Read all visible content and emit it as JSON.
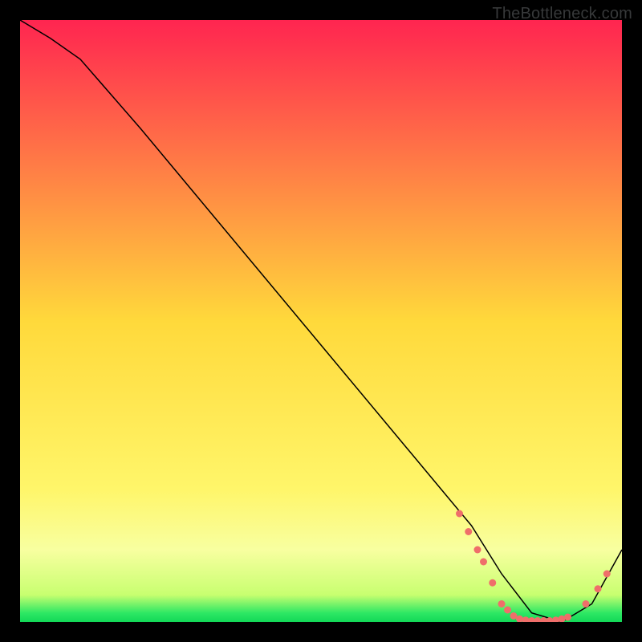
{
  "watermark": "TheBottleneck.com",
  "chart_data": {
    "type": "line",
    "title": "",
    "xlabel": "",
    "ylabel": "",
    "xlim": [
      0,
      100
    ],
    "ylim": [
      0,
      100
    ],
    "grid": false,
    "legend": false,
    "background_gradient": {
      "stops": [
        {
          "offset": 0.0,
          "color": "#ff2550"
        },
        {
          "offset": 0.5,
          "color": "#ffd93b"
        },
        {
          "offset": 0.78,
          "color": "#fff66a"
        },
        {
          "offset": 0.88,
          "color": "#f8ffa0"
        },
        {
          "offset": 0.955,
          "color": "#c8ff70"
        },
        {
          "offset": 0.985,
          "color": "#2ee864"
        },
        {
          "offset": 1.0,
          "color": "#12d857"
        }
      ]
    },
    "series": [
      {
        "name": "curve",
        "color": "#000000",
        "width": 1.5,
        "x": [
          0,
          5,
          10,
          20,
          30,
          40,
          50,
          60,
          70,
          75,
          80,
          85,
          90,
          95,
          100
        ],
        "y": [
          100,
          97,
          93.5,
          82,
          70,
          58,
          46,
          34,
          22,
          16,
          8,
          1.5,
          0,
          3,
          12
        ]
      }
    ],
    "markers": {
      "name": "highlight-dots",
      "color": "#ef6e6a",
      "radius": 4.5,
      "points": [
        {
          "x": 73.0,
          "y": 18.0
        },
        {
          "x": 74.5,
          "y": 15.0
        },
        {
          "x": 76.0,
          "y": 12.0
        },
        {
          "x": 77.0,
          "y": 10.0
        },
        {
          "x": 78.5,
          "y": 6.5
        },
        {
          "x": 80.0,
          "y": 3.0
        },
        {
          "x": 81.0,
          "y": 2.0
        },
        {
          "x": 82.0,
          "y": 1.0
        },
        {
          "x": 83.0,
          "y": 0.5
        },
        {
          "x": 84.0,
          "y": 0.3
        },
        {
          "x": 85.0,
          "y": 0.2
        },
        {
          "x": 86.0,
          "y": 0.2
        },
        {
          "x": 87.0,
          "y": 0.2
        },
        {
          "x": 88.0,
          "y": 0.2
        },
        {
          "x": 89.0,
          "y": 0.3
        },
        {
          "x": 90.0,
          "y": 0.5
        },
        {
          "x": 91.0,
          "y": 0.8
        },
        {
          "x": 94.0,
          "y": 3.0
        },
        {
          "x": 96.0,
          "y": 5.5
        },
        {
          "x": 97.5,
          "y": 8.0
        }
      ]
    }
  }
}
